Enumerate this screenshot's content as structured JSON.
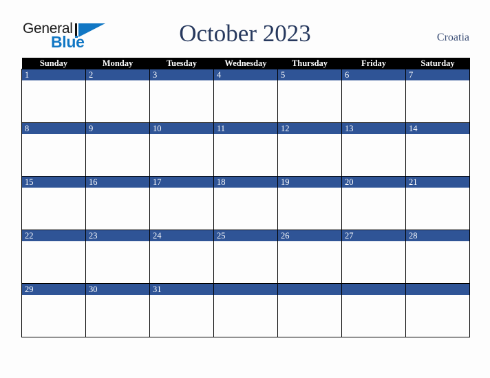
{
  "brand": {
    "name_part1": "General",
    "name_part2": "Blue",
    "triangle_icon": "triangle-icon",
    "accent_color": "#1177c4"
  },
  "header": {
    "title": "October 2023",
    "country": "Croatia",
    "title_color": "#27395e"
  },
  "calendar": {
    "month": "October",
    "year": "2023",
    "weekday_headers": [
      "Sunday",
      "Monday",
      "Tuesday",
      "Wednesday",
      "Thursday",
      "Friday",
      "Saturday"
    ],
    "header_bg_color": "#000000",
    "date_band_color": "#2f5496",
    "cell_bg_color": "#fdfdfd",
    "weeks": [
      {
        "days": [
          {
            "date": "1"
          },
          {
            "date": "2"
          },
          {
            "date": "3"
          },
          {
            "date": "4"
          },
          {
            "date": "5"
          },
          {
            "date": "6"
          },
          {
            "date": "7"
          }
        ]
      },
      {
        "days": [
          {
            "date": "8"
          },
          {
            "date": "9"
          },
          {
            "date": "10"
          },
          {
            "date": "11"
          },
          {
            "date": "12"
          },
          {
            "date": "13"
          },
          {
            "date": "14"
          }
        ]
      },
      {
        "days": [
          {
            "date": "15"
          },
          {
            "date": "16"
          },
          {
            "date": "17"
          },
          {
            "date": "18"
          },
          {
            "date": "19"
          },
          {
            "date": "20"
          },
          {
            "date": "21"
          }
        ]
      },
      {
        "days": [
          {
            "date": "22"
          },
          {
            "date": "23"
          },
          {
            "date": "24"
          },
          {
            "date": "25"
          },
          {
            "date": "26"
          },
          {
            "date": "27"
          },
          {
            "date": "28"
          }
        ]
      },
      {
        "days": [
          {
            "date": "29"
          },
          {
            "date": "30"
          },
          {
            "date": "31"
          },
          {
            "date": ""
          },
          {
            "date": ""
          },
          {
            "date": ""
          },
          {
            "date": ""
          }
        ]
      }
    ]
  }
}
